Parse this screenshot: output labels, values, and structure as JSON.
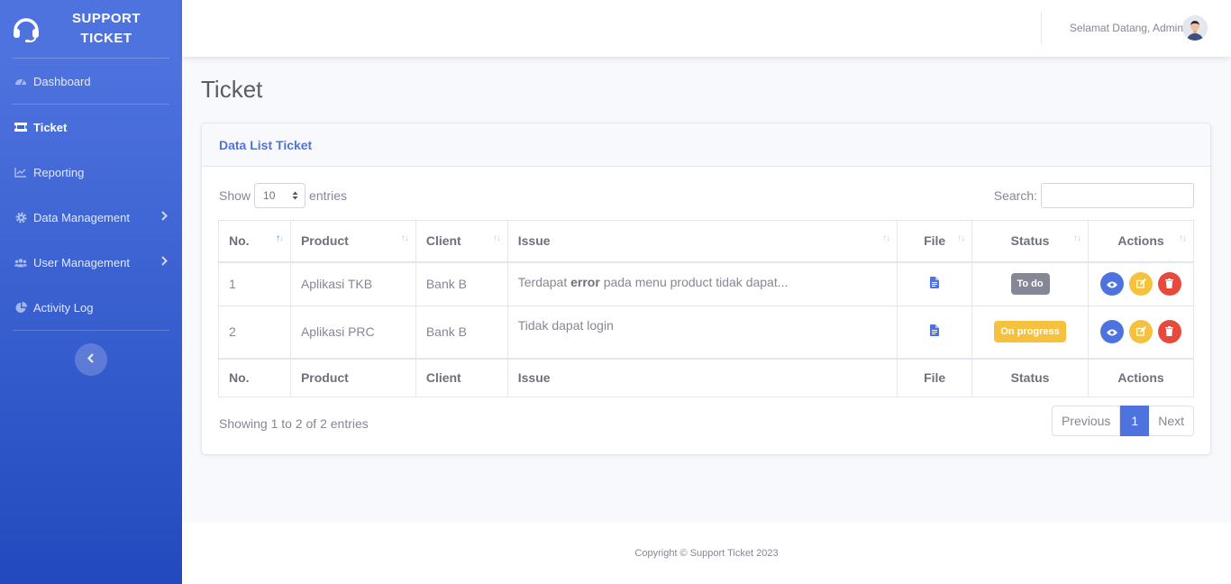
{
  "brand": {
    "line1": "SUPPORT",
    "line2": "TICKET",
    "icon": "headset-icon"
  },
  "sidebar": {
    "items": [
      {
        "label": "Dashboard",
        "icon": "tachometer-icon",
        "active": false
      },
      {
        "label": "Ticket",
        "icon": "ticket-icon",
        "active": true
      },
      {
        "label": "Reporting",
        "icon": "chart-line-icon",
        "active": false
      },
      {
        "label": "Data Management",
        "icon": "cog-icon",
        "active": false,
        "submenu": true
      },
      {
        "label": "User Management",
        "icon": "users-icon",
        "active": false,
        "submenu": true
      },
      {
        "label": "Activity Log",
        "icon": "pie-chart-icon",
        "active": false
      }
    ]
  },
  "topbar": {
    "welcome": "Selamat Datang, Admin"
  },
  "page": {
    "title": "Ticket"
  },
  "card": {
    "title": "Data List Ticket"
  },
  "controls": {
    "show_label": "Show",
    "entries_value": "10",
    "entries_label": "entries",
    "search_label": "Search:",
    "search_value": ""
  },
  "table": {
    "headers": [
      "No.",
      "Product",
      "Client",
      "Issue",
      "File",
      "Status",
      "Actions"
    ],
    "rows": [
      {
        "no": "1",
        "product": "Aplikasi TKB",
        "client": "Bank B",
        "issue_pre": "Terdapat ",
        "issue_bold": "error",
        "issue_post": " pada menu product tidak dapat...",
        "status": "To do"
      },
      {
        "no": "2",
        "product": "Aplikasi PRC",
        "client": "Bank B",
        "issue_pre": "Tidak dapat login",
        "issue_bold": "",
        "issue_post": "",
        "status": "On progress"
      }
    ]
  },
  "info": "Showing 1 to 2 of 2 entries",
  "pagination": {
    "previous": "Previous",
    "current": "1",
    "next": "Next"
  },
  "footer": "Copyright © Support Ticket 2023",
  "colors": {
    "primary": "#4e73df",
    "warning": "#f6c23e",
    "danger": "#e74a3b",
    "secondary": "#858796"
  }
}
